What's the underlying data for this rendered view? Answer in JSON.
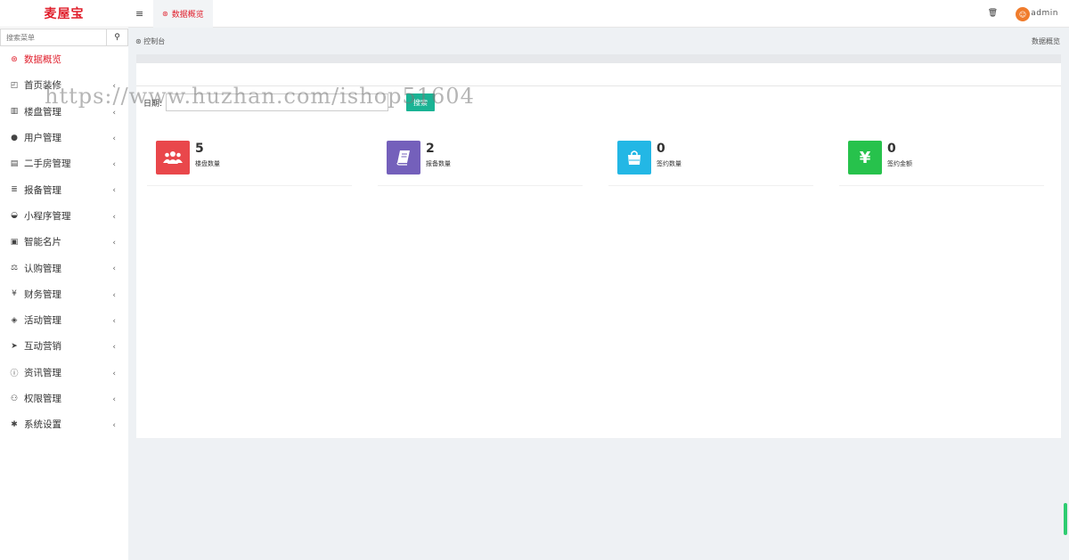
{
  "sidebar": {
    "logo": "麦屋宝",
    "search_placeholder": "搜索菜单",
    "items": [
      {
        "label": "数据概览",
        "icon": "dashboard-icon",
        "glyph": "⊛",
        "active": true,
        "chevron": ""
      },
      {
        "label": "首页装修",
        "icon": "layout-icon",
        "glyph": "◰",
        "active": false,
        "chevron": "‹"
      },
      {
        "label": "楼盘管理",
        "icon": "building-icon",
        "glyph": "▥",
        "active": false,
        "chevron": "‹"
      },
      {
        "label": "用户管理",
        "icon": "user-icon",
        "glyph": "●",
        "active": false,
        "chevron": "‹"
      },
      {
        "label": "二手房管理",
        "icon": "house-icon",
        "glyph": "▤",
        "active": false,
        "chevron": "‹"
      },
      {
        "label": "报备管理",
        "icon": "database-icon",
        "glyph": "≣",
        "active": false,
        "chevron": "‹"
      },
      {
        "label": "小程序管理",
        "icon": "wechat-icon",
        "glyph": "◒",
        "active": false,
        "chevron": "‹"
      },
      {
        "label": "智能名片",
        "icon": "card-icon",
        "glyph": "▣",
        "active": false,
        "chevron": "‹"
      },
      {
        "label": "认购管理",
        "icon": "balance-icon",
        "glyph": "⚖",
        "active": false,
        "chevron": "‹"
      },
      {
        "label": "财务管理",
        "icon": "yen-icon",
        "glyph": "¥",
        "active": false,
        "chevron": "‹"
      },
      {
        "label": "活动管理",
        "icon": "handshake-icon",
        "glyph": "◈",
        "active": false,
        "chevron": "‹"
      },
      {
        "label": "互动营销",
        "icon": "send-icon",
        "glyph": "➤",
        "active": false,
        "chevron": "‹"
      },
      {
        "label": "资讯管理",
        "icon": "info-icon",
        "glyph": "ⓘ",
        "active": false,
        "chevron": "‹"
      },
      {
        "label": "权限管理",
        "icon": "users-icon",
        "glyph": "⚇",
        "active": false,
        "chevron": "‹"
      },
      {
        "label": "系统设置",
        "icon": "gear-icon",
        "glyph": "✱",
        "active": false,
        "chevron": "‹"
      }
    ]
  },
  "topbar": {
    "menu_glyph": "≡",
    "tab_label": "数据概览",
    "trash_glyph": "🗑",
    "user": "admin"
  },
  "breadcrumb": {
    "left": "控制台",
    "right": "数据概览"
  },
  "filter": {
    "label": "日期:",
    "date_value": "",
    "search_label": "搜索"
  },
  "stats": [
    {
      "value": "5",
      "label": "楼盘数量",
      "icon": "users-group-icon",
      "glyph": "👥",
      "color": "#e9474b"
    },
    {
      "value": "2",
      "label": "报备数量",
      "icon": "book-icon",
      "glyph": "▰",
      "color": "#7460bb"
    },
    {
      "value": "0",
      "label": "签约数量",
      "icon": "shopping-bag-icon",
      "glyph": "◘",
      "color": "#23b7e5"
    },
    {
      "value": "0",
      "label": "签约金额",
      "icon": "yen-icon",
      "glyph": "¥",
      "color": "#27c24c"
    }
  ],
  "watermark": "https://www.huzhan.com/ishop51604",
  "colors": {
    "brand_red": "#e01e2b",
    "green_button": "#1ab394"
  }
}
